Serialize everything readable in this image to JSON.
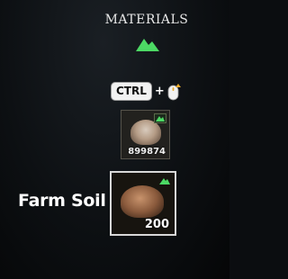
{
  "panel": {
    "title": "MATERIALS",
    "category_icon": "mountain-icon",
    "accent_color": "#4cd964"
  },
  "hint": {
    "key_label": "CTRL",
    "plus": "+",
    "mouse_icon": "mouse-scroll-up-icon"
  },
  "slots": [
    {
      "count": "899874",
      "icon": "soil-pile-icon",
      "badge_icon": "mountain-icon"
    },
    {
      "count": "200",
      "icon": "soil-pile-icon",
      "badge_icon": "mountain-icon",
      "selected": true
    }
  ],
  "selected_item": {
    "name": "Farm Soil"
  }
}
